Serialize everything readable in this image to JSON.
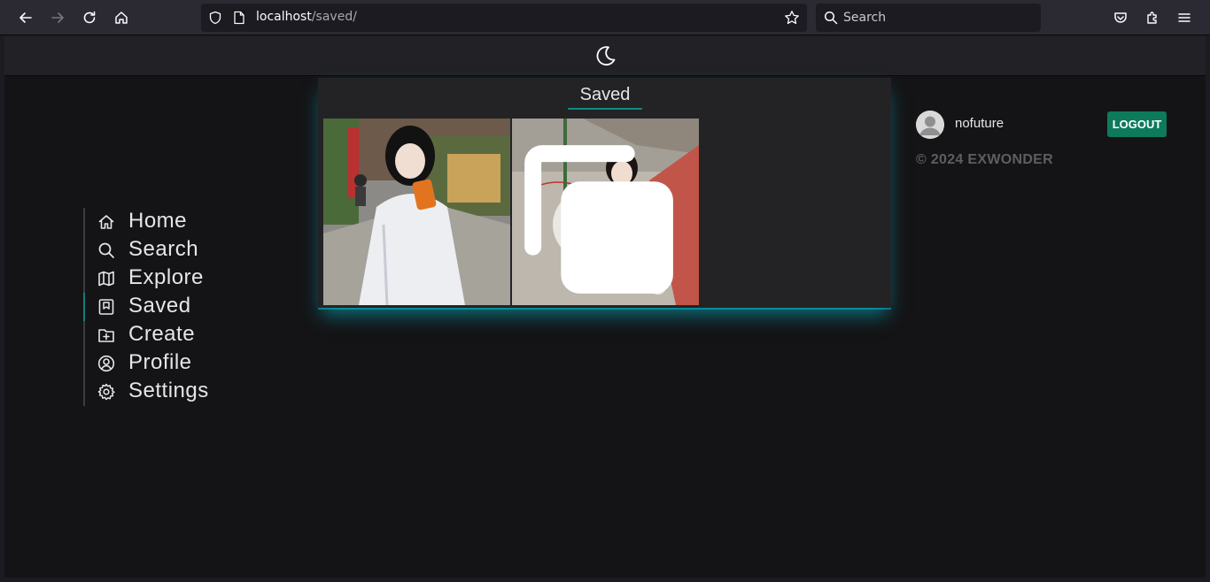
{
  "browser": {
    "url_host": "localhost",
    "url_path": "/saved/",
    "search_placeholder": "Search"
  },
  "sidebar": {
    "items": [
      {
        "label": "Home",
        "icon": "home-icon"
      },
      {
        "label": "Search",
        "icon": "search-icon"
      },
      {
        "label": "Explore",
        "icon": "map-icon"
      },
      {
        "label": "Saved",
        "icon": "bookmark-icon",
        "active": true
      },
      {
        "label": "Create",
        "icon": "folder-plus-icon"
      },
      {
        "label": "Profile",
        "icon": "user-circle-icon"
      },
      {
        "label": "Settings",
        "icon": "gear-icon"
      }
    ]
  },
  "main": {
    "title": "Saved",
    "posts": [
      {
        "image": "photo",
        "multiple": false
      },
      {
        "image": "photo",
        "multiple": true
      }
    ]
  },
  "user": {
    "username": "nofuture",
    "logout_label": "LOGOUT"
  },
  "footer": {
    "copyright": "© 2024 EXWONDER"
  },
  "colors": {
    "accent": "#0f8c86",
    "logout_bg": "#0d7a5c",
    "glow": "#00bed2"
  }
}
